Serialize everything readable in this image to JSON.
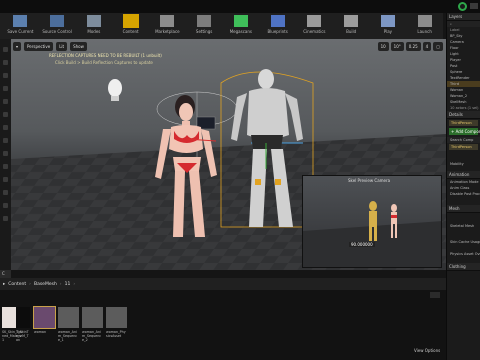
{
  "toolbar": {
    "items": [
      {
        "label": "Save Current",
        "icon": "save-icon"
      },
      {
        "label": "Source Control",
        "icon": "source-control-icon"
      },
      {
        "label": "Modes",
        "icon": "modes-icon"
      },
      {
        "label": "Content",
        "icon": "content-icon"
      },
      {
        "label": "Marketplace",
        "icon": "marketplace-icon"
      },
      {
        "label": "Settings",
        "icon": "settings-icon"
      },
      {
        "label": "Megascans",
        "icon": "megascans-icon"
      },
      {
        "label": "Blueprints",
        "icon": "blueprints-icon"
      },
      {
        "label": "Cinematics",
        "icon": "cinematics-icon"
      },
      {
        "label": "Build",
        "icon": "build-icon"
      },
      {
        "label": "Play",
        "icon": "play-icon"
      },
      {
        "label": "Launch",
        "icon": "launch-icon"
      }
    ],
    "active_index": 3,
    "accent": "#d6a400"
  },
  "viewport": {
    "perspective_label": "Perspective",
    "lit_label": "Lit",
    "show_label": "Show",
    "grid_snap": "10",
    "rot_snap": "10°",
    "scale_snap": "0.25",
    "cam_speed": "4",
    "message_1": "REFLECTION CAPTURES NEED TO BE REBUILT (1 unbuilt)",
    "message_2": "Click Build > Build Reflection Captures to update",
    "preview_title": "Skel Preview Camera",
    "preview_value": "90.000000"
  },
  "right": {
    "layers_title": "Layers",
    "label_col": "Label",
    "outliner_rows": [
      "BP_Sky",
      "Camera",
      "Floor",
      "Light",
      "Player",
      "Post",
      "Sphere",
      "TextRender",
      "Third",
      "Woman",
      "Woman_2",
      "SkelMesh"
    ],
    "actor_count": "10 actors (1 sel)",
    "details_title": "Details",
    "details_name": "ThirdPerson",
    "add_component": "+ Add Component",
    "search_placeholder": "Search Comp",
    "component_item": "ThirdPerson",
    "section_animation": "Animation",
    "animation_mode": "Animation Mode",
    "anim_class": "Anim Class",
    "disable_post": "Disable Post Process",
    "section_mesh": "Mesh",
    "skeletal_mesh": "Skeletal Mesh",
    "skin_cache": "Skin Cache Usage",
    "physics_asset": "Physics Asset Override",
    "section_clothing": "Clothing",
    "mobility": "Mobility"
  },
  "content_browser": {
    "tab_label": "C",
    "breadcrumb": [
      "Content",
      "BaseMesh",
      "11"
    ],
    "assets": [
      {
        "name": "SK_Skin_Tanned_Male_v1",
        "thumb_color": "#e8e0dc"
      },
      {
        "name": "T_SkinToneM_Tan",
        "thumb_color": "#0c0c0c"
      },
      {
        "name": "woman",
        "thumb_color": "#6a4a6e"
      },
      {
        "name": "woman_Anim_Sequence_1",
        "thumb_color": "#5c5c5c"
      },
      {
        "name": "woman_Anim_Sequence_2",
        "thumb_color": "#5c5c5c"
      },
      {
        "name": "woman_PhysicsAsset",
        "thumb_color": "#5c5c5c"
      }
    ],
    "view_options": "View Options"
  }
}
